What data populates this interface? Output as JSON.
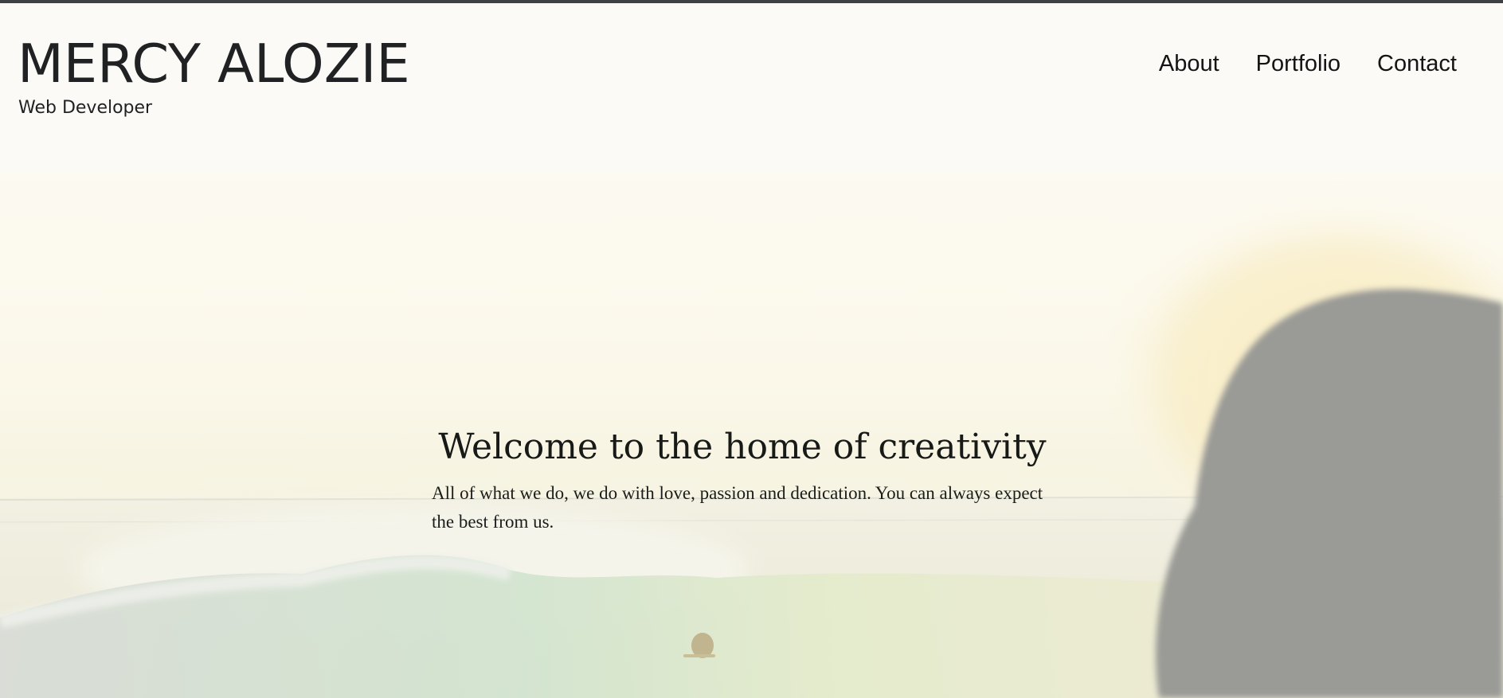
{
  "header": {
    "name": "MERCY ALOZIE",
    "role": "Web Developer"
  },
  "nav": {
    "items": [
      {
        "label": "About"
      },
      {
        "label": "Portfolio"
      },
      {
        "label": "Contact"
      }
    ]
  },
  "hero": {
    "title": "Welcome to the home of creativity",
    "text": "All of what we do, we do with love, passion and dedication. You can always expect the best from us."
  },
  "colors": {
    "page_background": "#fbfaf7",
    "top_rule": "#3e4043",
    "text": "#1f2123",
    "silhouette": "#9a9a96"
  }
}
